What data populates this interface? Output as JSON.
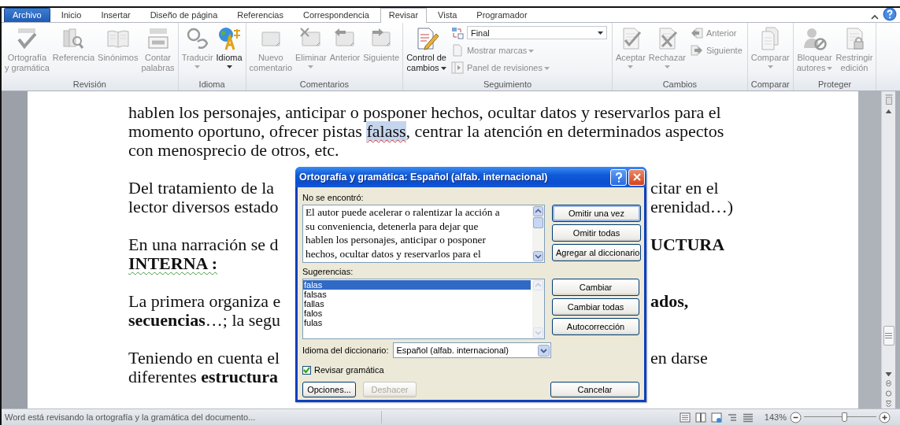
{
  "ribbon": {
    "tabs": [
      {
        "label": "Archivo",
        "kind": "file",
        "selected": false
      },
      {
        "label": "Inicio",
        "kind": "tab",
        "selected": false
      },
      {
        "label": "Insertar",
        "kind": "tab",
        "selected": false
      },
      {
        "label": "Diseño de página",
        "kind": "tab",
        "selected": false
      },
      {
        "label": "Referencias",
        "kind": "tab",
        "selected": false
      },
      {
        "label": "Correspondencia",
        "kind": "tab",
        "selected": false
      },
      {
        "label": "Revisar",
        "kind": "tab",
        "selected": true
      },
      {
        "label": "Vista",
        "kind": "tab",
        "selected": false
      },
      {
        "label": "Programador",
        "kind": "tab",
        "selected": false
      }
    ],
    "groups": [
      {
        "label": "Revisión",
        "items": [
          {
            "kind": "large",
            "label": "Ortografía\ny gramática",
            "disabled": true
          },
          {
            "kind": "large",
            "label": "Referencia",
            "disabled": true
          },
          {
            "kind": "large",
            "label": "Sinónimos",
            "disabled": true
          },
          {
            "kind": "large",
            "label": "Contar\npalabras",
            "disabled": true
          }
        ]
      },
      {
        "label": "Idioma",
        "items": [
          {
            "kind": "large",
            "label": "Traducir",
            "disabled": true,
            "dropdown": true
          },
          {
            "kind": "large",
            "label": "Idioma",
            "disabled": false,
            "dropdown": true
          }
        ]
      },
      {
        "label": "Comentarios",
        "items": [
          {
            "kind": "large",
            "label": "Nuevo\ncomentario",
            "disabled": true
          },
          {
            "kind": "large",
            "label": "Eliminar",
            "disabled": true,
            "dropdown": true
          },
          {
            "kind": "large",
            "label": "Anterior",
            "disabled": true
          },
          {
            "kind": "large",
            "label": "Siguiente",
            "disabled": true
          }
        ]
      },
      {
        "label": "Seguimiento",
        "items": [
          {
            "kind": "large",
            "label": "Control de\ncambios",
            "disabled": false,
            "dropdown": true,
            "arrow_inline": true
          },
          {
            "kind": "select",
            "value": "Final"
          },
          {
            "kind": "small",
            "label": "Mostrar marcas",
            "disabled": true,
            "dropdown": true
          },
          {
            "kind": "small",
            "label": "Panel de revisiones",
            "disabled": true,
            "dropdown": true
          }
        ]
      },
      {
        "label": "Cambios",
        "items": [
          {
            "kind": "large",
            "label": "Aceptar",
            "disabled": true,
            "dropdown": true
          },
          {
            "kind": "large",
            "label": "Rechazar",
            "disabled": true,
            "dropdown": true
          },
          {
            "kind": "small",
            "label": "Anterior",
            "disabled": true
          },
          {
            "kind": "small",
            "label": "Siguiente",
            "disabled": true
          }
        ]
      },
      {
        "label": "Comparar",
        "items": [
          {
            "kind": "large",
            "label": "Comparar",
            "disabled": true,
            "dropdown": true
          }
        ]
      },
      {
        "label": "Proteger",
        "items": [
          {
            "kind": "large",
            "label": "Bloquear\nautores",
            "disabled": true,
            "dropdown": true,
            "arrow_inline": true
          },
          {
            "kind": "large",
            "label": "Restringir\nedición",
            "disabled": true
          }
        ]
      }
    ]
  },
  "document": {
    "lines": [
      {
        "kind": "full",
        "text": "hablen los personajes, anticipar o posponer hechos, ocultar datos y reservarlos para el"
      },
      {
        "kind": "flagged",
        "before": "momento oportuno, ofrecer pistas ",
        "word": "falass",
        "after": ", centrar la atención en determinados aspectos"
      },
      {
        "kind": "full",
        "text": "con menosprecio de otros, etc."
      },
      {
        "kind": "blank"
      },
      {
        "kind": "split",
        "left": "Del tratamiento de la",
        "right": "citar en el"
      },
      {
        "kind": "split",
        "left": "lector diversos estado",
        "right": "erenidad…)"
      },
      {
        "kind": "blank"
      },
      {
        "kind": "split",
        "left": "En una narración se d",
        "right": "UCTURA",
        "right_bold": true
      },
      {
        "kind": "full",
        "text": "INTERNA :",
        "bold": true,
        "grammar_flag": true
      },
      {
        "kind": "blank"
      },
      {
        "kind": "split",
        "left": "La primera organiza e",
        "right": "ados,",
        "right_bold": true
      },
      {
        "kind": "split",
        "left": "**secuencias**…; la segu"
      },
      {
        "kind": "blank"
      },
      {
        "kind": "split",
        "left": "Teniendo en cuenta el",
        "right": "en darse"
      },
      {
        "kind": "split",
        "left": "diferentes **estructura**"
      }
    ]
  },
  "spelling_dialog": {
    "title": "Ortografía y gramática: Español (alfab. internacional)",
    "not_found_label": "No se encontró:",
    "not_found_lines": [
      "El autor puede acelerar o ralentizar la acción a",
      "su conveniencia, detenerla para dejar que",
      "hablen los personajes, anticipar o posponer",
      "hechos, ocultar datos y reservarlos para el"
    ],
    "top_buttons": [
      {
        "label": "Omitir una vez",
        "focused": true
      },
      {
        "label": "Omitir todas",
        "focused": false
      },
      {
        "label": "Agregar al diccionario",
        "focused": false
      }
    ],
    "suggestions_label": "Sugerencias:",
    "suggestions": [
      {
        "text": "falas",
        "selected": true
      },
      {
        "text": "falsas",
        "selected": false
      },
      {
        "text": "fallas",
        "selected": false
      },
      {
        "text": "falos",
        "selected": false
      },
      {
        "text": "fulas",
        "selected": false
      }
    ],
    "middle_buttons": [
      {
        "label": "Cambiar",
        "focused": false
      },
      {
        "label": "Cambiar todas",
        "focused": false
      },
      {
        "label": "Autocorrección",
        "focused": false
      }
    ],
    "dictionary_label": "Idioma del diccionario:",
    "dictionary_value": "Español (alfab. internacional)",
    "check_grammar": {
      "label": "Revisar gramática",
      "checked": true
    },
    "bottom_buttons": [
      {
        "label": "Opciones...",
        "disabled": false
      },
      {
        "label": "Deshacer",
        "disabled": true
      },
      {
        "label": "Cancelar",
        "disabled": false
      }
    ]
  },
  "status_bar": {
    "message": "Word está revisando la ortografía y la gramática del documento...",
    "zoom_label": "143%",
    "zoom": {
      "level": 0.55
    }
  }
}
